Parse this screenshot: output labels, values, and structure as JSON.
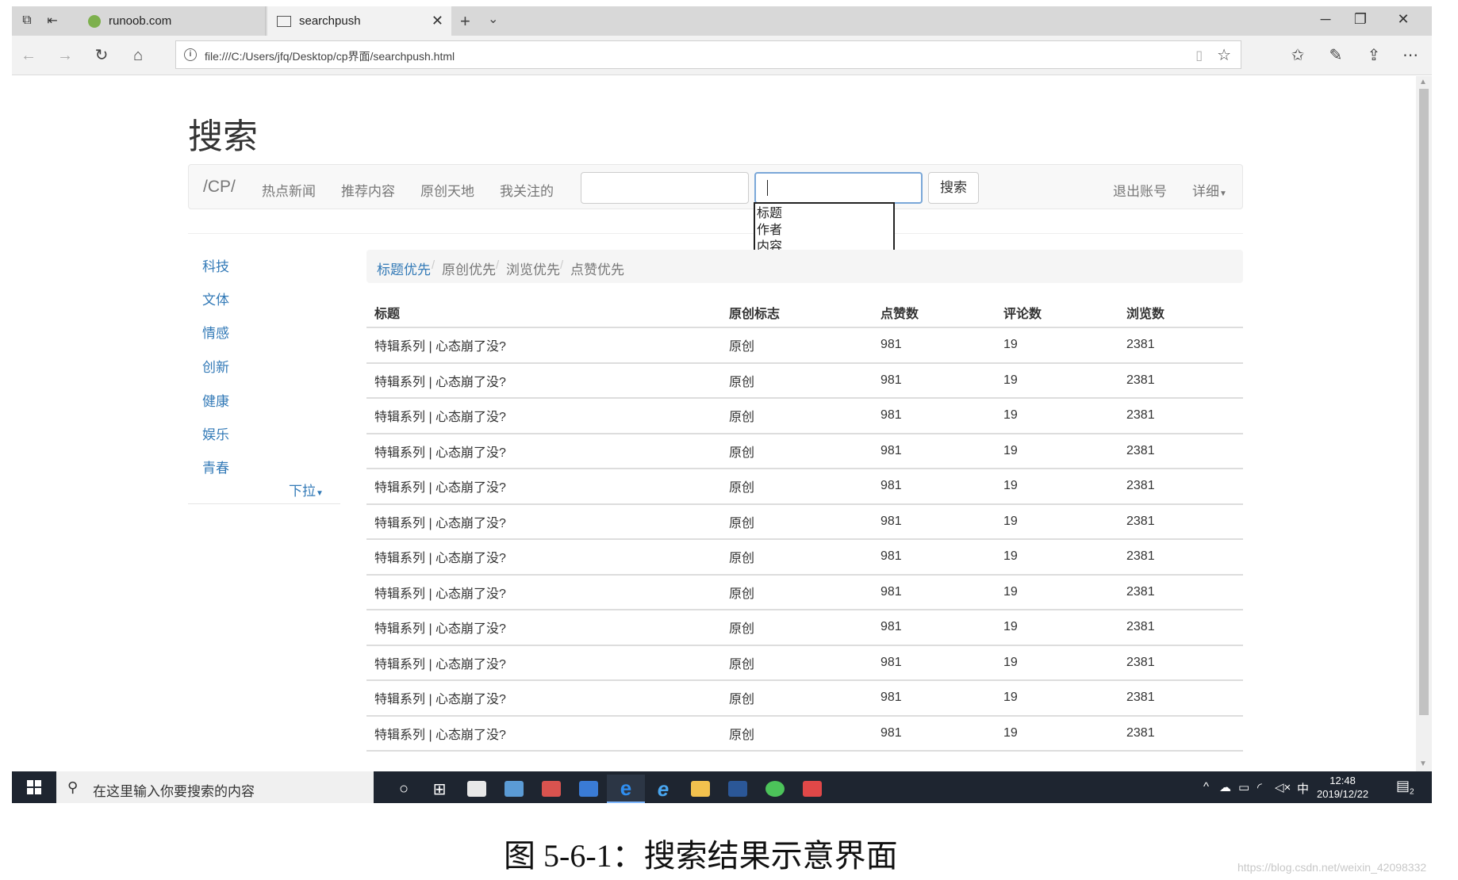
{
  "browser": {
    "tabs": [
      {
        "label": "runoob.com"
      },
      {
        "label": "searchpush"
      }
    ],
    "url": "file:///C:/Users/jfq/Desktop/cp界面/searchpush.html"
  },
  "page": {
    "title": "搜索",
    "brand": "/CP/",
    "nav_links": [
      "热点新闻",
      "推荐内容",
      "原创天地",
      "我关注的"
    ],
    "search_button": "搜索",
    "logout": "退出账号",
    "detail": "详细",
    "dropdown_options": [
      "标题",
      "作者",
      "内容"
    ],
    "categories": [
      "科技",
      "文体",
      "情感",
      "创新",
      "健康",
      "娱乐",
      "青春"
    ],
    "more": "下拉",
    "breadcrumb": [
      "标题优先",
      "原创优先",
      "浏览优先",
      "点赞优先"
    ],
    "table": {
      "headers": [
        "标题",
        "原创标志",
        "点赞数",
        "评论数",
        "浏览数"
      ],
      "rows": [
        [
          "特辑系列 | 心态崩了没?",
          "原创",
          "981",
          "19",
          "2381"
        ],
        [
          "特辑系列 | 心态崩了没?",
          "原创",
          "981",
          "19",
          "2381"
        ],
        [
          "特辑系列 | 心态崩了没?",
          "原创",
          "981",
          "19",
          "2381"
        ],
        [
          "特辑系列 | 心态崩了没?",
          "原创",
          "981",
          "19",
          "2381"
        ],
        [
          "特辑系列 | 心态崩了没?",
          "原创",
          "981",
          "19",
          "2381"
        ],
        [
          "特辑系列 | 心态崩了没?",
          "原创",
          "981",
          "19",
          "2381"
        ],
        [
          "特辑系列 | 心态崩了没?",
          "原创",
          "981",
          "19",
          "2381"
        ],
        [
          "特辑系列 | 心态崩了没?",
          "原创",
          "981",
          "19",
          "2381"
        ],
        [
          "特辑系列 | 心态崩了没?",
          "原创",
          "981",
          "19",
          "2381"
        ],
        [
          "特辑系列 | 心态崩了没?",
          "原创",
          "981",
          "19",
          "2381"
        ],
        [
          "特辑系列 | 心态崩了没?",
          "原创",
          "981",
          "19",
          "2381"
        ],
        [
          "特辑系列 | 心态崩了没?",
          "原创",
          "981",
          "19",
          "2381"
        ]
      ]
    }
  },
  "taskbar": {
    "search_placeholder": "在这里输入你要搜索的内容",
    "ime": "中",
    "time": "12:48",
    "date": "2019/12/22",
    "notification_count": "2"
  },
  "caption": "图 5-6-1：搜索结果示意界面",
  "watermark": "https://blog.csdn.net/weixin_42098332",
  "colors": {
    "link": "#337ab7",
    "taskbar": "#1e2530"
  }
}
